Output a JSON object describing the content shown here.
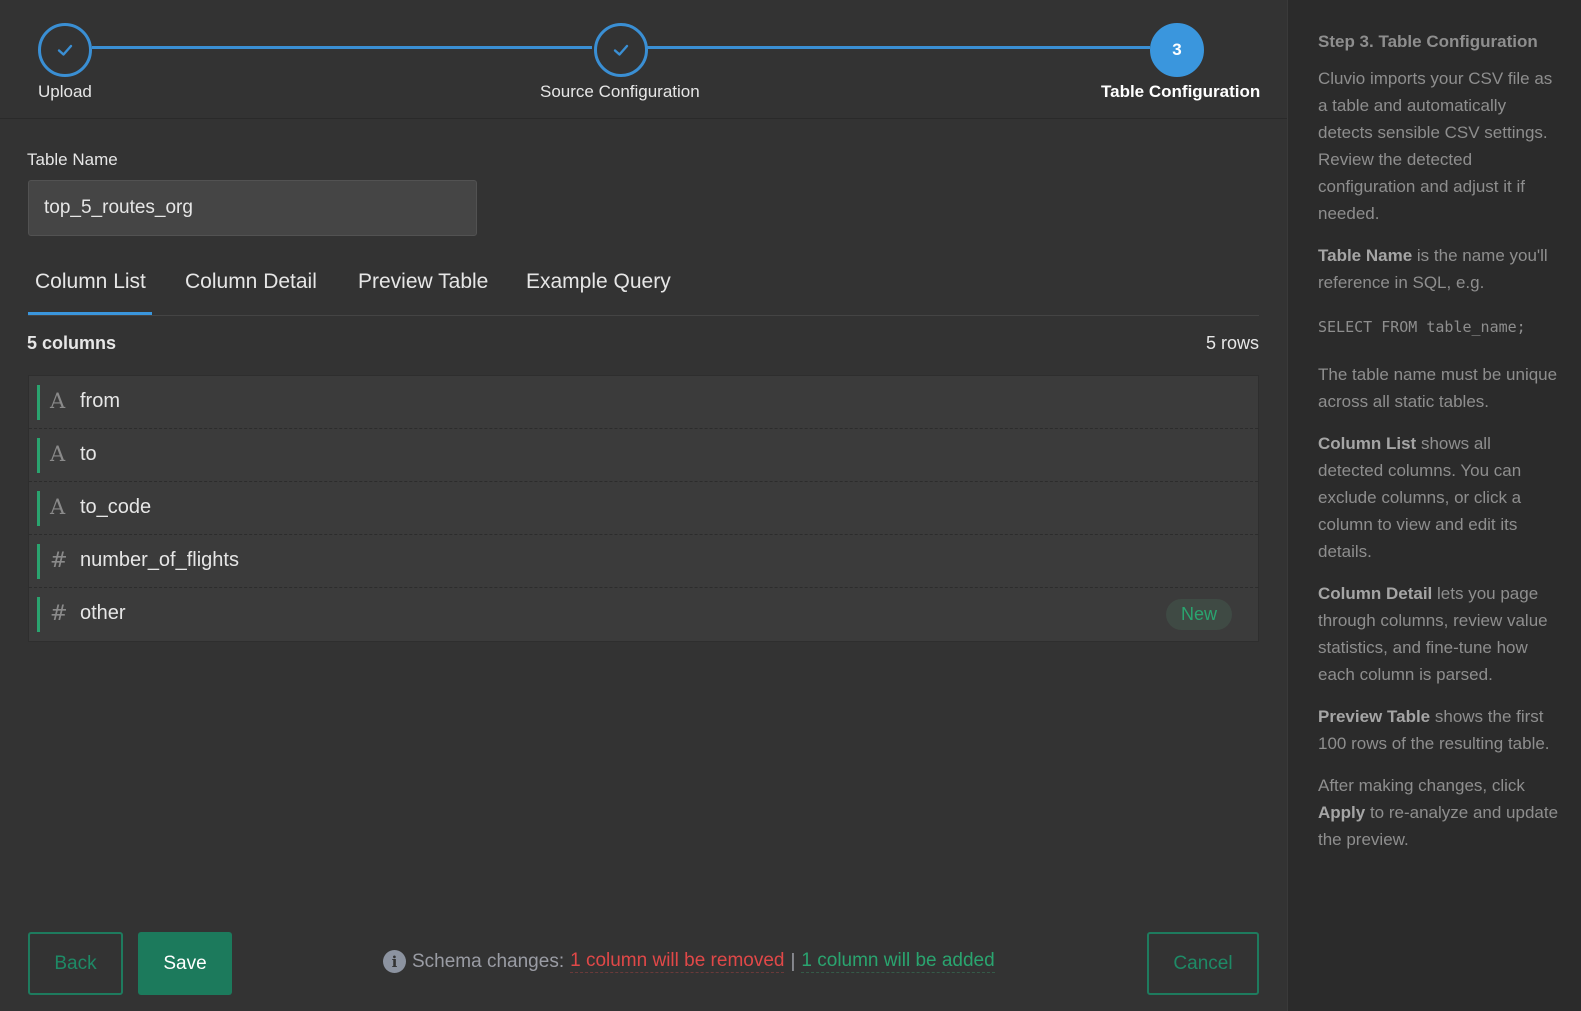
{
  "stepper": {
    "steps": [
      {
        "label": "Upload",
        "state": "done",
        "icon": "check-icon"
      },
      {
        "label": "Source Configuration",
        "state": "done",
        "icon": "check-icon"
      },
      {
        "label": "Table Configuration",
        "state": "active",
        "number": "3"
      }
    ]
  },
  "form": {
    "table_name_label": "Table Name",
    "table_name_value": "top_5_routes_org"
  },
  "tabs": [
    "Column List",
    "Column Detail",
    "Preview Table",
    "Example Query"
  ],
  "active_tab": "Column List",
  "summary": {
    "columns": "5 columns",
    "rows": "5 rows"
  },
  "columns": [
    {
      "type_icon": "A",
      "type": "text",
      "name": "from",
      "badge": ""
    },
    {
      "type_icon": "A",
      "type": "text",
      "name": "to",
      "badge": ""
    },
    {
      "type_icon": "A",
      "type": "text",
      "name": "to_code",
      "badge": ""
    },
    {
      "type_icon": "#",
      "type": "number",
      "name": "number_of_flights",
      "badge": ""
    },
    {
      "type_icon": "#",
      "type": "number",
      "name": "other",
      "badge": "New"
    }
  ],
  "footer": {
    "back_label": "Back",
    "save_label": "Save",
    "cancel_label": "Cancel",
    "schema_prefix": "Schema changes:",
    "schema_removed": "1 column will be removed",
    "schema_separator": "|",
    "schema_added": "1 column will be added"
  },
  "sidebar": {
    "title": "Step 3. Table Configuration",
    "intro": "Cluvio imports your CSV file as a table and automatically detects sensible CSV settings. Review the detected configuration and adjust it if needed.",
    "table_name_term": "Table Name",
    "table_name_desc": " is the name you'll reference in SQL, e.g.",
    "sql_example": "SELECT FROM table_name;",
    "unique_note": "The table name must be unique across all static tables.",
    "column_list_term": "Column List",
    "column_list_desc": " shows all detected columns. You can exclude columns, or click a column to view and edit its details.",
    "column_detail_term": "Column Detail",
    "column_detail_desc": " lets you page through columns, review value statistics, and fine-tune how each column is parsed.",
    "preview_term": "Preview Table",
    "preview_desc": " shows the first 100 rows of the resulting table.",
    "apply_prefix": "After making changes, click ",
    "apply_term": "Apply",
    "apply_suffix": " to re-analyze and update the preview."
  },
  "colors": {
    "accent_blue": "#3a96dd",
    "accent_green": "#1c7a5c",
    "removed_red": "#e04848",
    "added_green": "#2aa46f"
  }
}
